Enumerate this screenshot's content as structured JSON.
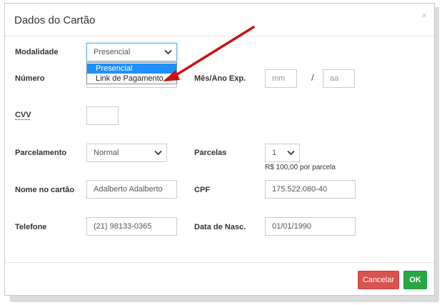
{
  "modal": {
    "title": "Dados do Cartão",
    "close_glyph": "×"
  },
  "form": {
    "modalidade": {
      "label": "Modalidade",
      "value": "Presencial",
      "options": [
        "Presencial",
        "Link de Pagamento"
      ],
      "highlighted_option": "Presencial"
    },
    "numero": {
      "label": "Número",
      "value": ""
    },
    "mes_ano": {
      "label": "Mês/Ano Exp.",
      "month_placeholder": "mm",
      "year_placeholder": "aa",
      "separator": "/"
    },
    "cvv": {
      "label": "CVV",
      "value": ""
    },
    "parcelamento": {
      "label": "Parcelamento",
      "value": "Normal"
    },
    "parcelas": {
      "label": "Parcelas",
      "value": "1",
      "hint": "R$ 100,00 por parcela"
    },
    "nome": {
      "label": "Nome no cartão",
      "value": "Adalberto Adalberto"
    },
    "cpf": {
      "label": "CPF",
      "value": "175.522.080-40"
    },
    "telefone": {
      "label": "Telefone",
      "value": "(21) 98133-0365"
    },
    "nascimento": {
      "label": "Data de Nasc.",
      "value": "01/01/1990"
    }
  },
  "footer": {
    "cancel_label": "Cancelar",
    "ok_label": "OK"
  },
  "colors": {
    "cancel": "#d9534f",
    "ok": "#28a745",
    "selection": "#1e90ff",
    "annotation_arrow": "#cc1111"
  },
  "icons": [
    "close-icon",
    "chevron-down-icon",
    "annotation-arrow"
  ]
}
